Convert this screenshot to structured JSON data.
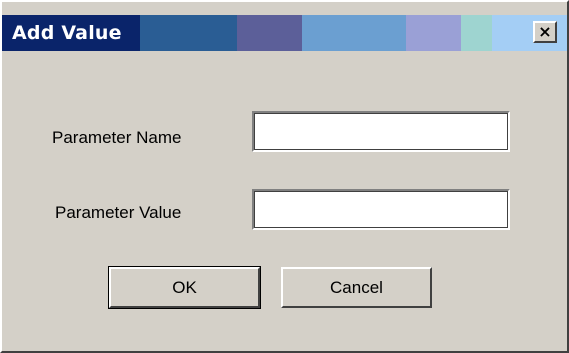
{
  "window": {
    "title": "Add Value",
    "close_glyph": "×",
    "close_icon": "close-icon"
  },
  "form": {
    "name_label": "Parameter Name",
    "name_value": "",
    "value_label": "Parameter Value",
    "value_value": ""
  },
  "buttons": {
    "ok_label": "OK",
    "cancel_label": "Cancel"
  },
  "colors": {
    "dialog_bg": "#d4d0c8",
    "title_text": "#ffffff",
    "titlebar_segments": [
      "#0a246a",
      "#2a5d94",
      "#3a6b9e",
      "#6a6aa6",
      "#6ea3d8",
      "#9aa0d6",
      "#9cd4d0",
      "#a4cef5"
    ]
  }
}
